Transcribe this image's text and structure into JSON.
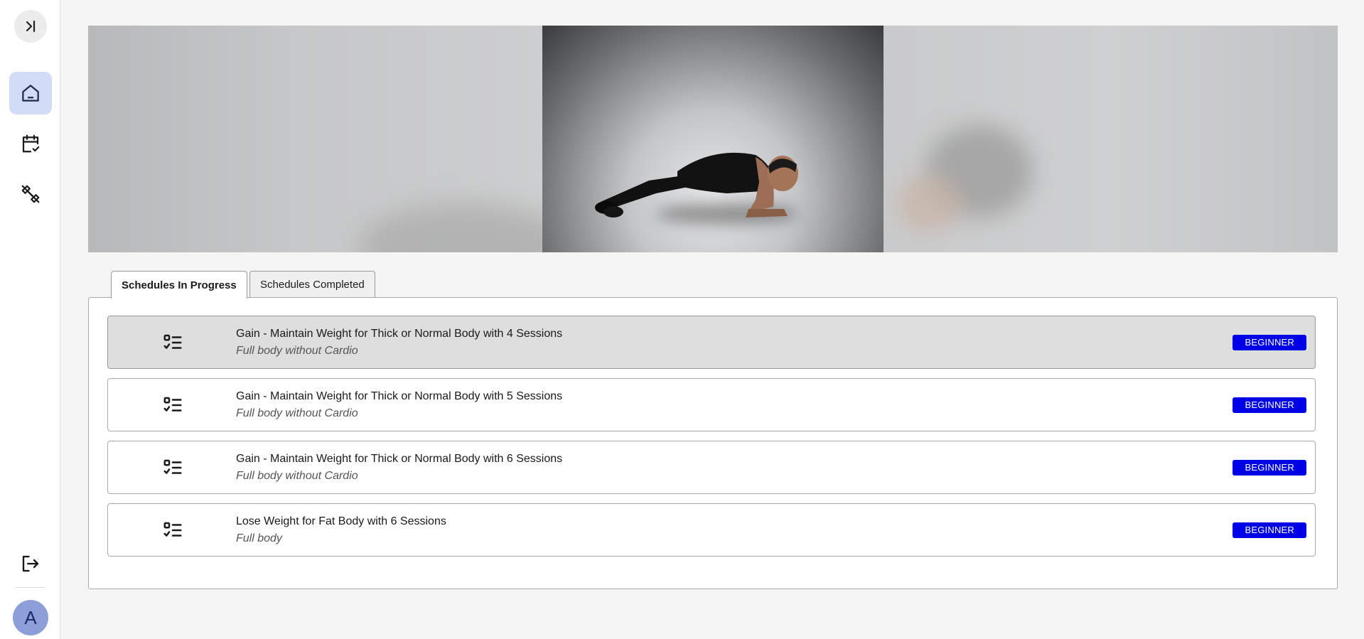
{
  "sidebar": {
    "items": [
      {
        "name": "home",
        "icon": "home-icon",
        "active": true
      },
      {
        "name": "calendar",
        "icon": "calendar-check-icon",
        "active": false
      },
      {
        "name": "workouts",
        "icon": "dumbbell-off-icon",
        "active": false
      }
    ],
    "avatar_initial": "A",
    "collapse_icon": "sidebar-expand-icon",
    "logout_icon": "logout-icon"
  },
  "tabs": [
    {
      "label": "Schedules In Progress",
      "active": true
    },
    {
      "label": "Schedules Completed",
      "active": false
    }
  ],
  "schedules": [
    {
      "title": "Gain - Maintain Weight for Thick or Normal Body with 4 Sessions",
      "subtitle": "Full body without Cardio",
      "level": "BEGINNER"
    },
    {
      "title": "Gain - Maintain Weight for Thick or Normal Body with 5 Sessions",
      "subtitle": "Full body without Cardio",
      "level": "BEGINNER"
    },
    {
      "title": "Gain - Maintain Weight for Thick or Normal Body with 6 Sessions",
      "subtitle": "Full body without Cardio",
      "level": "BEGINNER"
    },
    {
      "title": "Lose Weight for Fat Body with 6 Sessions",
      "subtitle": "Full body",
      "level": "BEGINNER"
    }
  ],
  "colors": {
    "badge": "#0000e6",
    "active_nav": "#d3dcf6",
    "avatar": "#8d9fd9"
  }
}
